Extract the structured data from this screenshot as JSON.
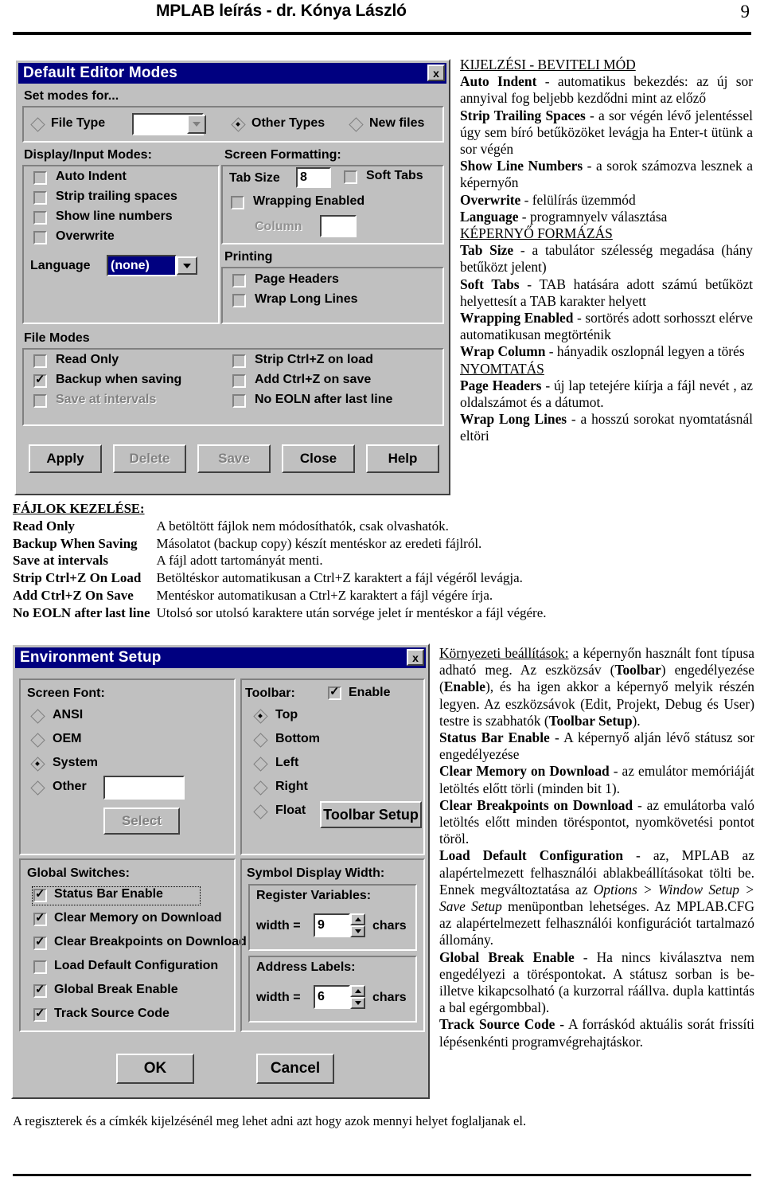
{
  "page": {
    "header_title": "MPLAB leírás - dr. Kónya László",
    "page_number": "9",
    "footer_note": "A regiszterek és a címkék kijelzésénél meg lehet adni azt hogy azok mennyi helyet foglaljanak el."
  },
  "theme": {
    "titlebar": "#000080",
    "dialog_face": "#c0c0c0",
    "shadow": "#808080",
    "highlight": "#ffffff"
  },
  "editor_dialog": {
    "title": "Default Editor Modes",
    "close_label": "x",
    "set_modes_label": "Set modes for...",
    "mode_options": [
      {
        "label": "File Type",
        "selected": false
      },
      {
        "label": "Other Types",
        "selected": true
      },
      {
        "label": "New files",
        "selected": false
      }
    ],
    "file_type_value": "",
    "display_input": {
      "label": "Display/Input Modes:",
      "checkboxes": [
        {
          "label": "Auto Indent",
          "checked": false,
          "disabled": false
        },
        {
          "label": "Strip trailing spaces",
          "checked": false,
          "disabled": false
        },
        {
          "label": "Show line numbers",
          "checked": false,
          "disabled": false
        },
        {
          "label": "Overwrite",
          "checked": false,
          "disabled": false
        }
      ],
      "language_label": "Language",
      "language_value": "(none)"
    },
    "screen_formatting": {
      "label": "Screen Formatting:",
      "tab_size_label": "Tab Size",
      "tab_size_value": "8",
      "soft_tabs_label": "Soft Tabs",
      "soft_tabs_checked": false,
      "wrapping_label": "Wrapping Enabled",
      "wrapping_checked": false,
      "column_label": "Column",
      "column_value": ""
    },
    "printing": {
      "label": "Printing",
      "checkboxes": [
        {
          "label": "Page Headers",
          "checked": false
        },
        {
          "label": "Wrap Long Lines",
          "checked": false
        }
      ]
    },
    "file_modes": {
      "label": "File Modes",
      "left": [
        {
          "label": "Read Only",
          "checked": false,
          "disabled": false
        },
        {
          "label": "Backup when saving",
          "checked": true,
          "disabled": false
        },
        {
          "label": "Save at intervals",
          "checked": false,
          "disabled": true
        }
      ],
      "right": [
        {
          "label": "Strip Ctrl+Z on load",
          "checked": false,
          "disabled": false
        },
        {
          "label": "Add Ctrl+Z on save",
          "checked": false,
          "disabled": false
        },
        {
          "label": "No EOLN after last line",
          "checked": false,
          "disabled": false
        }
      ]
    },
    "buttons": [
      {
        "label": "Apply",
        "disabled": false
      },
      {
        "label": "Delete",
        "disabled": true
      },
      {
        "label": "Save",
        "disabled": true
      },
      {
        "label": "Close",
        "disabled": false
      },
      {
        "label": "Help",
        "disabled": false
      }
    ]
  },
  "editor_notes": {
    "section1_heading": "KIJELZÉSI - BEVITELI MÓD",
    "items1": [
      {
        "term": "Auto Indent",
        "desc": " - automatikus bekezdés: az új sor annyival fog beljebb kezdődni mint az előző"
      },
      {
        "term": "Strip Trailing Spaces",
        "desc": " -  a sor végén lévő jelentéssel úgy sem bíró betűközöket levágja ha Enter-t ütünk a sor végén"
      },
      {
        "term": "Show Line Numbers",
        "desc": "  - a sorok számozva lesznek a képernyőn"
      },
      {
        "term": "Overwrite",
        "desc": " - felülírás üzemmód"
      },
      {
        "term": "Language",
        "desc": " - programnyelv választása"
      }
    ],
    "section2_heading": "KÉPERNYŐ FORMÁZÁS",
    "items2": [
      {
        "term": "Tab Size",
        "desc": " - a tabulátor szélesség megadása (hány betűközt jelent)"
      },
      {
        "term": "Soft Tabs",
        "desc": " - TAB hatására adott számú betűközt helyettesít a TAB karakter helyett"
      },
      {
        "term": "Wrapping Enabled",
        "desc": " - sortörés adott sorhosszt elérve automatikusan megtörténik"
      },
      {
        "term": "Wrap Column",
        "desc": " - hányadik oszlopnál legyen a törés"
      }
    ],
    "section3_heading": "NYOMTATÁS",
    "items3": [
      {
        "term": "Page Headers",
        "desc": " - új lap tetejére kiírja a fájl nevét , az oldalszámot és a dátumot."
      },
      {
        "term": "Wrap Long Lines",
        "desc": " - a hosszú sorokat nyomtatásnál eltöri"
      }
    ]
  },
  "file_table": {
    "heading": "FÁJLOK KEZELÉSE:",
    "rows": [
      {
        "term": "Read Only",
        "desc": " A betöltött fájlok nem módosíthatók, csak olvashatók."
      },
      {
        "term": "Backup When Saving",
        "desc": "Másolatot (backup copy) készít mentéskor az eredeti fájlról."
      },
      {
        "term": "Save at intervals",
        "desc": "A fájl adott tartományát menti."
      },
      {
        "term": "Strip Ctrl+Z On Load",
        "desc": "Betöltéskor automatikusan a Ctrl+Z karaktert a fájl végéről levágja."
      },
      {
        "term": "Add Ctrl+Z On Save",
        "desc": "Mentéskor automatikusan a Ctrl+Z karaktert a fájl végére írja."
      },
      {
        "term": "No EOLN after last line",
        "desc": "Utolsó sor utolsó karaktere után sorvége jelet ír mentéskor a fájl végére."
      }
    ]
  },
  "env_dialog": {
    "title": "Environment Setup",
    "close_label": "x",
    "screen_font": {
      "label": "Screen Font:",
      "options": [
        {
          "label": "ANSI",
          "selected": false
        },
        {
          "label": "OEM",
          "selected": false
        },
        {
          "label": "System",
          "selected": true
        },
        {
          "label": "Other",
          "selected": false
        }
      ],
      "other_value": "",
      "select_button": "Select",
      "select_disabled": true
    },
    "toolbar": {
      "label": "Toolbar:",
      "enable_label": "Enable",
      "enable_checked": true,
      "options": [
        {
          "label": "Top",
          "selected": true
        },
        {
          "label": "Bottom",
          "selected": false
        },
        {
          "label": "Left",
          "selected": false
        },
        {
          "label": "Right",
          "selected": false
        },
        {
          "label": "Float",
          "selected": false
        }
      ],
      "setup_button": "Toolbar Setup"
    },
    "global_switches": {
      "label": "Global Switches:",
      "checkboxes": [
        {
          "label": "Status Bar Enable",
          "checked": true,
          "focused": true
        },
        {
          "label": "Clear Memory on Download",
          "checked": true,
          "focused": false
        },
        {
          "label": "Clear Breakpoints on Download",
          "checked": true,
          "focused": false
        },
        {
          "label": "Load Default Configuration",
          "checked": false,
          "focused": false
        },
        {
          "label": "Global Break Enable",
          "checked": true,
          "focused": false
        },
        {
          "label": "Track Source Code",
          "checked": true,
          "focused": false
        }
      ]
    },
    "symbol_display_width": {
      "label": "Symbol Display Width:",
      "groups": [
        {
          "label": "Register Variables:",
          "prefix": "width =",
          "value": "9",
          "suffix": "chars"
        },
        {
          "label": "Address Labels:",
          "prefix": "width =",
          "value": "6",
          "suffix": "chars"
        }
      ]
    },
    "buttons": [
      {
        "label": "OK"
      },
      {
        "label": "Cancel"
      }
    ]
  },
  "env_notes": {
    "intro_heading": "Környezeti beállítások:",
    "intro_body": " a képernyőn használt font típusa adható meg. Az eszközsáv (Toolbar) engedélyezése (Enable), és ha igen akkor a képernyő melyik részén legyen. Az eszközsávok (Edit, Projekt, Debug és User) testre is szabhatók (Toolbar Setup).",
    "items": [
      {
        "term": "Status Bar Enable",
        "desc": " - A képernyő alján lévő státusz sor engedélyezése"
      },
      {
        "term": "Clear Memory on Download",
        "desc": " - az emulátor memóriáját letöltés előtt törli (minden bit 1)."
      },
      {
        "term": "Clear Breakpoints on Download",
        "desc": " - az emulátorba való letöltés előtt minden töréspontot, nyomkövetési pontot töröl."
      },
      {
        "term": "Load Default Configuration",
        "desc": " - az, MPLAB az alapértelmezett felhasználói ablakbeállításokat tölti be. Ennek megváltoztatása az Options > Window Setup > Save Setup menüpontban lehetséges. Az MPLAB.CFG az alapértelmezett felhasználói konfigurációt tartalmazó állomány."
      },
      {
        "term": "Global Break Enable",
        "desc": "  - Ha nincs kiválasztva nem engedélyezi a töréspontokat. A státusz sorban is be- illetve kikapcsolható (a kurzorral ráállva. dupla kattintás a bal egérgombbal)."
      },
      {
        "term": "Track Source Code -",
        "desc": " A forráskód aktuális sorát frissíti lépésenkénti programvégrehajtáskor."
      }
    ]
  }
}
